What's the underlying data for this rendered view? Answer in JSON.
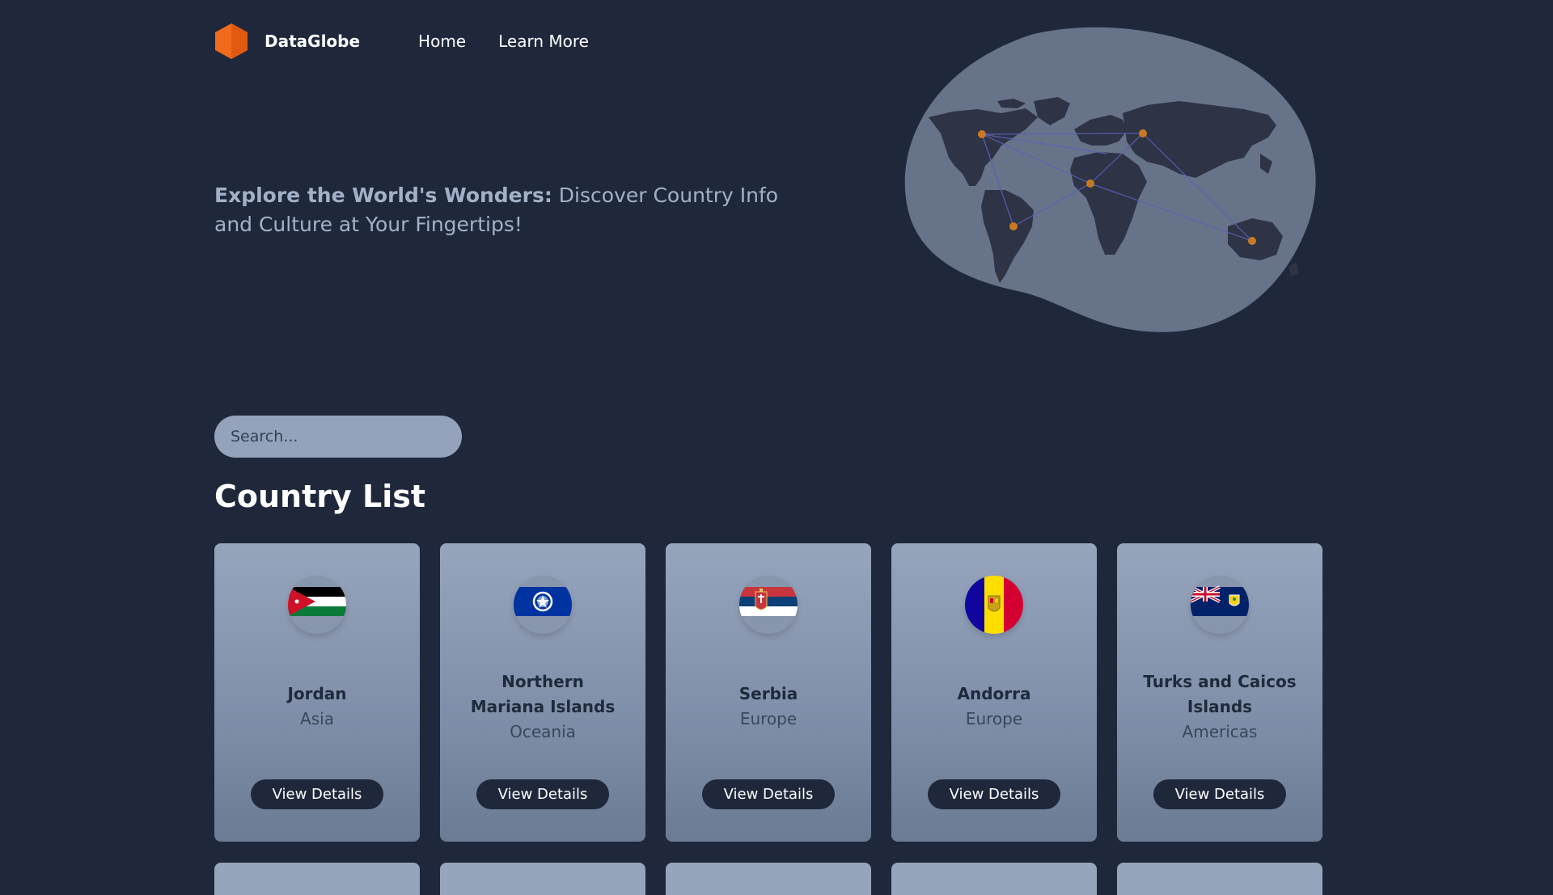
{
  "nav": {
    "brand": "DataGlobe",
    "links": [
      "Home",
      "Learn More"
    ]
  },
  "hero": {
    "headline_bold": "Explore the World's Wonders:",
    "headline_rest": " Discover Country Info and Culture at Your Fingertips!"
  },
  "search": {
    "placeholder": "Search..."
  },
  "section_title": "Country List",
  "countries": [
    {
      "name": "Jordan",
      "region": "Asia",
      "button": "View Details",
      "flag": "jordan-flag-icon"
    },
    {
      "name": "Northern Mariana Islands",
      "region": "Oceania",
      "button": "View Details",
      "flag": "northern-mariana-islands-flag-icon"
    },
    {
      "name": "Serbia",
      "region": "Europe",
      "button": "View Details",
      "flag": "serbia-flag-icon"
    },
    {
      "name": "Andorra",
      "region": "Europe",
      "button": "View Details",
      "flag": "andorra-flag-icon"
    },
    {
      "name": "Turks and Caicos Islands",
      "region": "Americas",
      "button": "View Details",
      "flag": "turks-and-caicos-flag-icon"
    }
  ],
  "colors": {
    "background": "#1f283b",
    "accent": "#f26a1b",
    "card": "#8f9db5",
    "button": "#1f283b"
  }
}
